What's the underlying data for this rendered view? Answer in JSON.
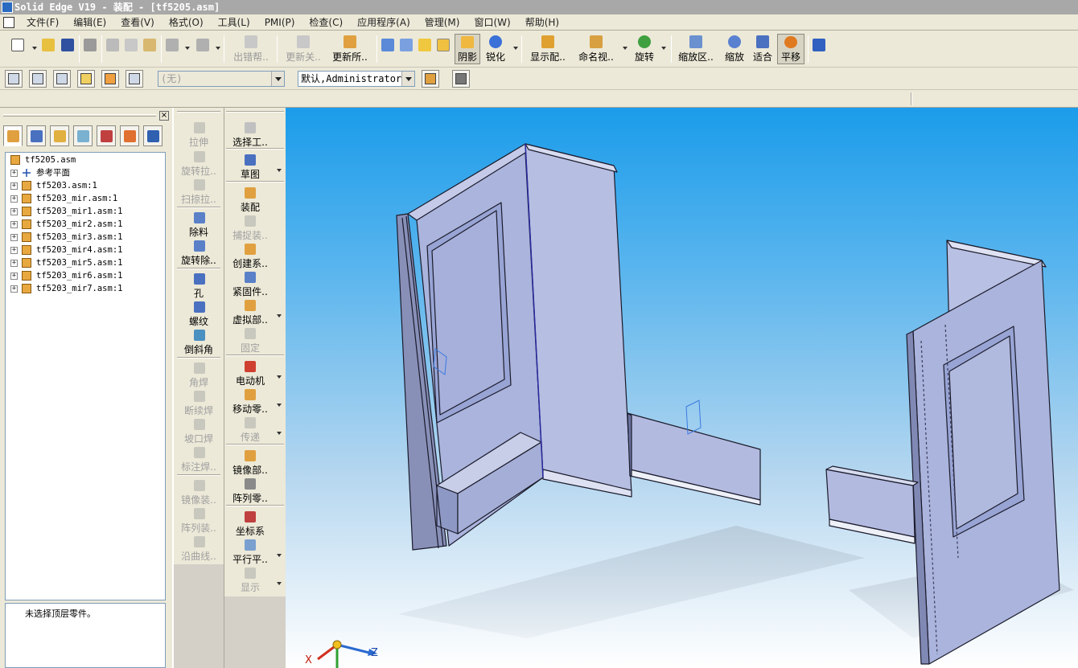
{
  "window": {
    "title": "Solid Edge V19 - 装配 - [tf5205.asm]"
  },
  "menu": {
    "items": [
      "文件(F)",
      "编辑(E)",
      "查看(V)",
      "格式(O)",
      "工具(L)",
      "PMI(P)",
      "检查(C)",
      "应用程序(A)",
      "管理(M)",
      "窗口(W)",
      "帮助(H)"
    ]
  },
  "toolbar": {
    "labels": {
      "error_help": "出错帮..",
      "update_related": "更新关..",
      "update_all": "更新所..",
      "shading": "阴影",
      "sharpen": "锐化",
      "display_config": "显示配..",
      "named_views": "命名视..",
      "rotate": "旋转",
      "zoom_area": "缩放区..",
      "zoom": "缩放",
      "fit": "适合",
      "pan": "平移"
    }
  },
  "toolbar2": {
    "layer_select": "(无)",
    "user_select": "默认,Administrator"
  },
  "pathfinder": {
    "root": "tf5205.asm",
    "items": [
      "参考平面",
      "tf5203.asm:1",
      "tf5203_mir.asm:1",
      "tf5203_mir1.asm:1",
      "tf5203_mir2.asm:1",
      "tf5203_mir3.asm:1",
      "tf5203_mir4.asm:1",
      "tf5203_mir5.asm:1",
      "tf5203_mir6.asm:1",
      "tf5203_mir7.asm:1"
    ],
    "status": "未选择顶层零件。"
  },
  "features_col": [
    "拉伸",
    "旋转拉..",
    "扫掠拉..",
    "除料",
    "旋转除..",
    "孔",
    "螺纹",
    "倒斜角",
    "角焊",
    "断续焊",
    "坡口焊",
    "标注焊..",
    "镜像装..",
    "阵列装..",
    "沿曲线.."
  ],
  "assembly_col": [
    "选择工..",
    "草图",
    "装配",
    "捕捉装..",
    "创建系..",
    "紧固件..",
    "虚拟部..",
    "固定",
    "电动机",
    "移动零..",
    "传递",
    "镜像部..",
    "阵列零..",
    "坐标系",
    "平行平..",
    "显示"
  ],
  "triad": {
    "x": "X",
    "z": "Z"
  },
  "colors": {
    "viewport_top": "#1b9cea",
    "part_face": "#aab4dc",
    "part_edge": "#1a1a2a"
  }
}
